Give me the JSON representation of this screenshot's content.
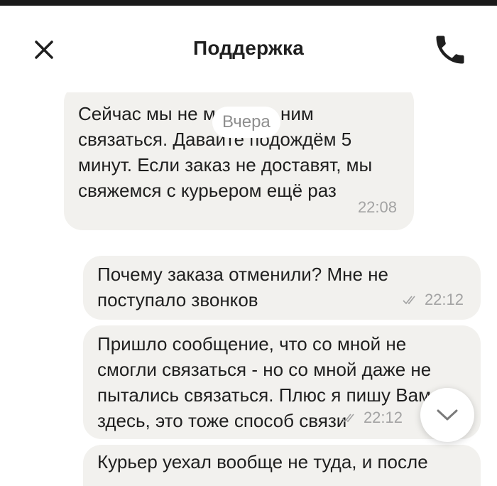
{
  "header": {
    "title": "Поддержка",
    "close_icon": "close-icon",
    "phone_icon": "phone-icon"
  },
  "date_separator": "Вчера",
  "messages": [
    {
      "direction": "incoming",
      "text": "Сейчас мы не можем с ним\nсвязаться. Давайте подождём 5\nминут. Если заказ не доставят, мы\nсвяжемся с курьером ещё раз",
      "time": "22:08"
    },
    {
      "direction": "outgoing",
      "text": "Почему заказа отменили? Мне не\nпоступало звонков",
      "time": "22:12",
      "status_icon": "double-check-icon"
    },
    {
      "direction": "outgoing",
      "text": "Пришло сообщение, что со мной не\nсмогли связаться - но со мной даже не\nпытались связаться. Плюс я пишу Вам\nздесь, это тоже способ связи",
      "time": "22:12",
      "status_icon": "double-check-icon"
    },
    {
      "direction": "outgoing",
      "text": "Курьер уехал вообще не туда, и после",
      "time": ""
    }
  ],
  "scroll_button_icon": "chevron-down-icon",
  "colors": {
    "bubble": "#f2f1ee",
    "text": "#1f1f1f",
    "meta": "#a3a3a3"
  }
}
